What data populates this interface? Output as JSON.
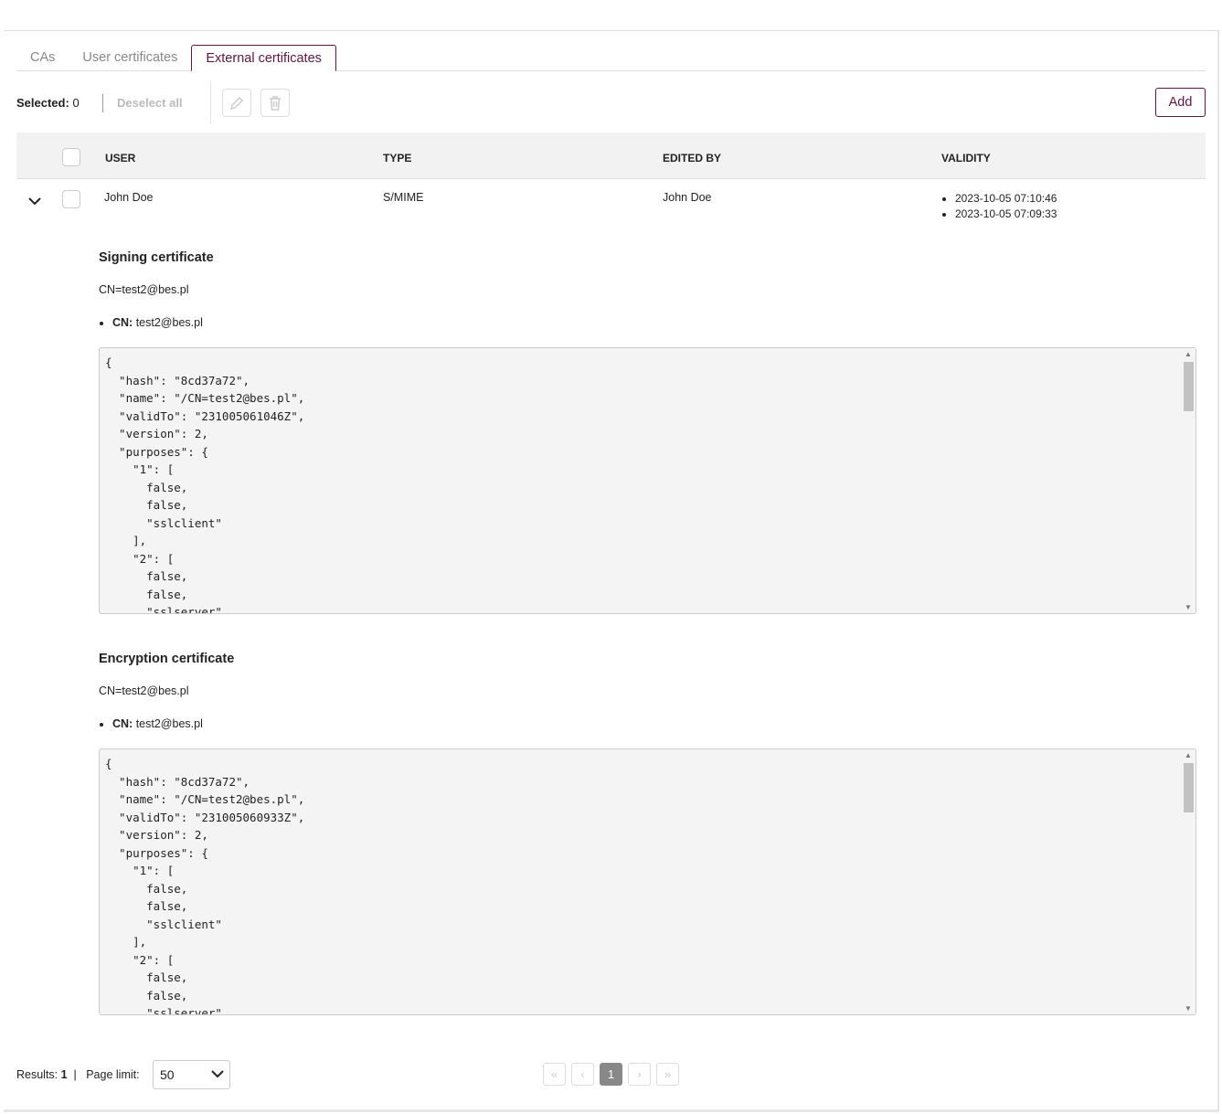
{
  "tabs": [
    {
      "label": "CAs"
    },
    {
      "label": "User certificates"
    },
    {
      "label": "External certificates",
      "active": true
    }
  ],
  "toolbar": {
    "selected_label": "Selected:",
    "selected_count": "0",
    "deselect_all": "Deselect all",
    "add": "Add",
    "edit_icon": "pencil-icon",
    "delete_icon": "trash-icon"
  },
  "table": {
    "columns": [
      "USER",
      "TYPE",
      "EDITED BY",
      "VALIDITY"
    ],
    "rows": [
      {
        "user": "John Doe",
        "type": "S/MIME",
        "edited_by": "John Doe",
        "validity": [
          "2023-10-05 07:10:46",
          "2023-10-05 07:09:33"
        ],
        "expanded": true
      }
    ]
  },
  "details": [
    {
      "title": "Signing certificate",
      "dn": "CN=test2@bes.pl",
      "attr_key": "CN:",
      "attr_value": "test2@bes.pl",
      "code": [
        "{",
        "  \"hash\": \"8cd37a72\",",
        "  \"name\": \"/CN=test2@bes.pl\",",
        "  \"validTo\": \"231005061046Z\",",
        "  \"version\": 2,",
        "  \"purposes\": {",
        "    \"1\": [",
        "      false,",
        "      false,",
        "      \"sslclient\"",
        "    ],",
        "    \"2\": [",
        "      false,",
        "      false,",
        "      \"sslserver\""
      ]
    },
    {
      "title": "Encryption certificate",
      "dn": "CN=test2@bes.pl",
      "attr_key": "CN:",
      "attr_value": "test2@bes.pl",
      "code": [
        "{",
        "  \"hash\": \"8cd37a72\",",
        "  \"name\": \"/CN=test2@bes.pl\",",
        "  \"validTo\": \"231005060933Z\",",
        "  \"version\": 2,",
        "  \"purposes\": {",
        "    \"1\": [",
        "      false,",
        "      false,",
        "      \"sslclient\"",
        "    ],",
        "    \"2\": [",
        "      false,",
        "      false,",
        "      \"sslserver\""
      ]
    }
  ],
  "footer": {
    "results_label": "Results:",
    "results_count": "1",
    "page_limit_label": "Page limit:",
    "page_limit": "50",
    "pages": {
      "first": "«",
      "prev": "‹",
      "current": "1",
      "next": "›",
      "last": "»"
    }
  },
  "colors": {
    "accent": "#5a1746"
  }
}
